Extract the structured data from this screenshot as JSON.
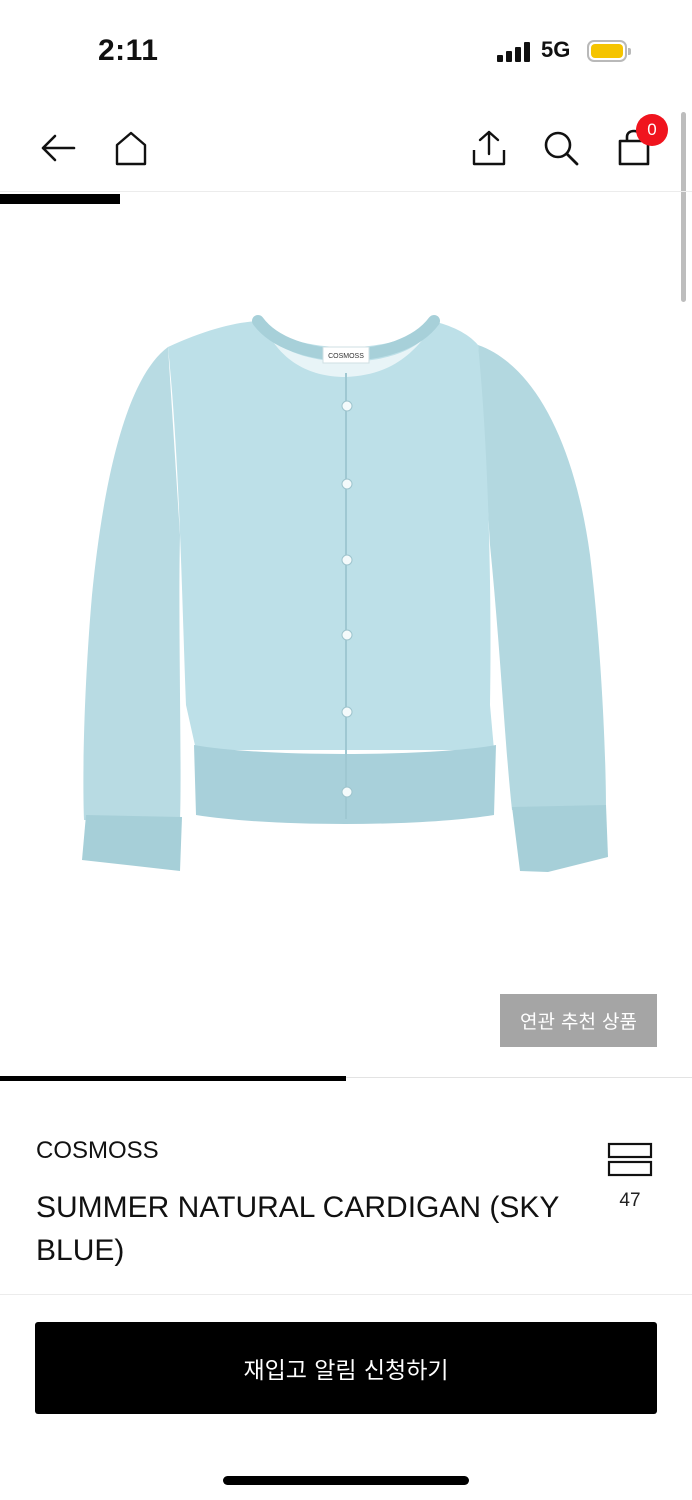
{
  "status_bar": {
    "time": "2:11",
    "network": "5G"
  },
  "header": {
    "cart_count": "0"
  },
  "gallery": {
    "label_tag": "COSMOSS",
    "related_button": "연관 추천 상품",
    "progress": 0.5
  },
  "product": {
    "brand": "COSMOSS",
    "title": "SUMMER NATURAL CARDIGAN (SKY BLUE)",
    "like_count": "47"
  },
  "cta": {
    "label": "재입고 알림 신청하기"
  },
  "colors": {
    "cardigan": "#b8dbe3",
    "badge": "#f0141e",
    "battery": "#f5c400"
  }
}
